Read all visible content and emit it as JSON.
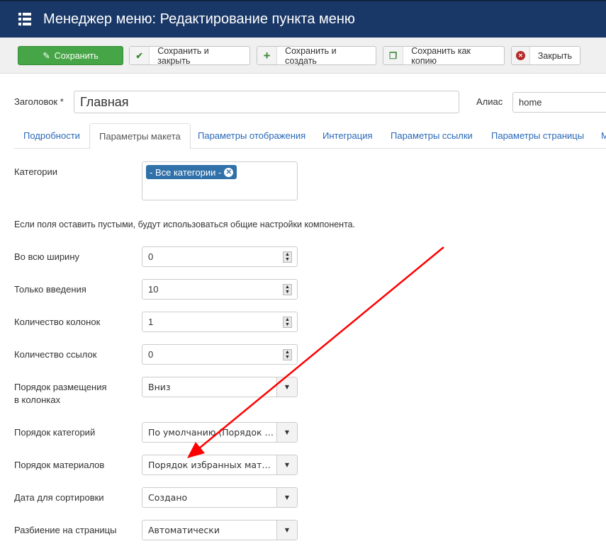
{
  "header": {
    "title": "Менеджер меню: Редактирование пункта меню"
  },
  "toolbar": {
    "save": "Сохранить",
    "save_close": "Сохранить и закрыть",
    "save_new": "Сохранить и создать",
    "save_copy": "Сохранить как копию",
    "close": "Закрыть"
  },
  "form": {
    "title_label": "Заголовок *",
    "title_value": "Главная",
    "alias_label": "Алиас",
    "alias_value": "home"
  },
  "tabs": [
    "Подробности",
    "Параметры макета",
    "Параметры отображения",
    "Интеграция",
    "Параметры ссылки",
    "Параметры страницы",
    "М"
  ],
  "layout": {
    "categories_label": "Категории",
    "category_chip": "- Все категории -",
    "note": "Если поля оставить пустыми, будут использоваться общие настройки компонента.",
    "fields": [
      {
        "label": "Во всю ширину",
        "value": "0"
      },
      {
        "label": "Только введения",
        "value": "10"
      },
      {
        "label": "Количество колонок",
        "value": "1"
      },
      {
        "label": "Количество ссылок",
        "value": "0"
      }
    ],
    "selects": [
      {
        "label1": "Порядок размещения",
        "label2": "в колонках",
        "value": "Вниз"
      },
      {
        "label1": "Порядок категорий",
        "value": "По умолчанию (Порядок в J..."
      },
      {
        "label1": "Порядок материалов",
        "value": "Порядок избранных матери..."
      },
      {
        "label1": "Дата для сортировки",
        "value": "Создано"
      },
      {
        "label1": "Разбиение на страницы",
        "value": "Автоматически"
      }
    ]
  },
  "annotation": {
    "arrow_color": "#ff0000"
  }
}
